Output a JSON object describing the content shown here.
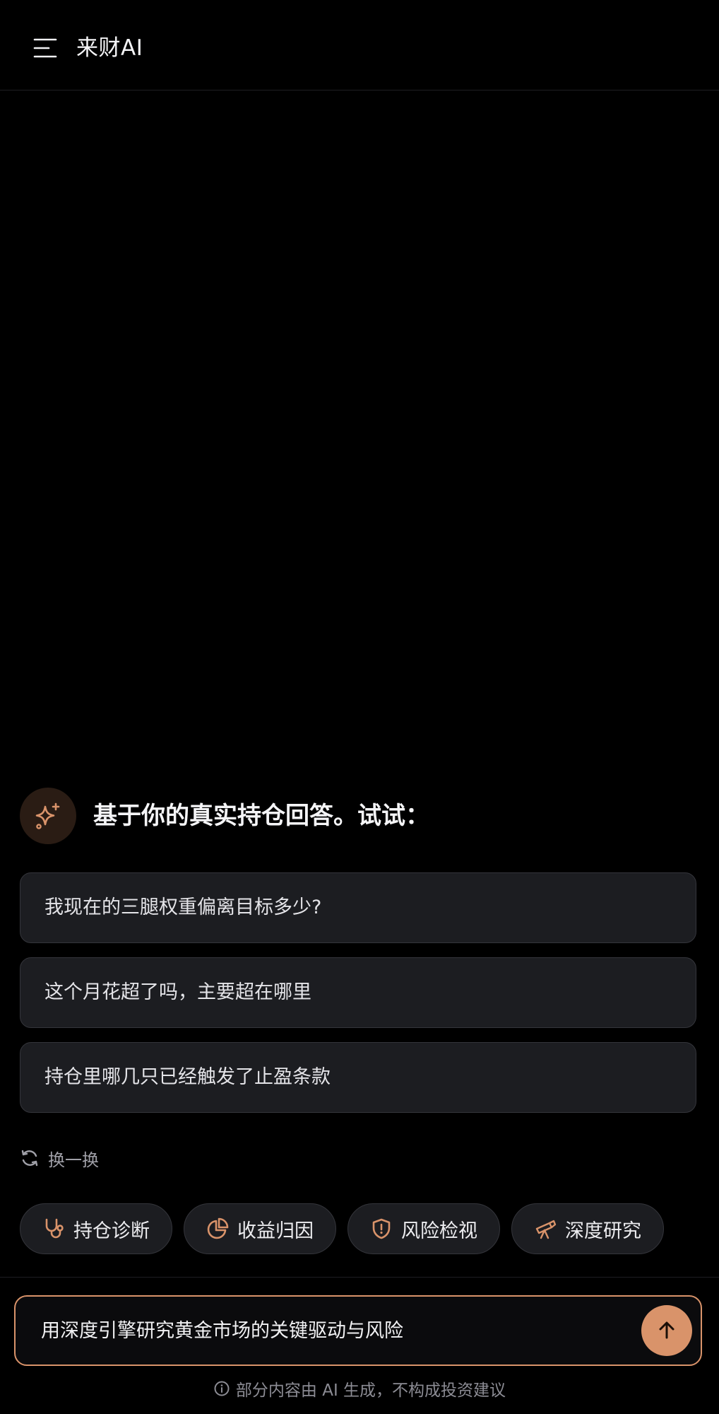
{
  "header": {
    "title": "来财AI",
    "menu_icon": "hamburger-menu-icon"
  },
  "prompt": {
    "icon": "sparkle-icon",
    "heading": "基于你的真实持仓回答。试试："
  },
  "suggestions": [
    {
      "text": "我现在的三腿权重偏离目标多少?"
    },
    {
      "text": "这个月花超了吗，主要超在哪里"
    },
    {
      "text": "持仓里哪几只已经触发了止盈条款"
    }
  ],
  "refresh": {
    "icon": "refresh-icon",
    "label": "换一换"
  },
  "chips": [
    {
      "label": "持仓诊断",
      "icon": "stethoscope-icon"
    },
    {
      "label": "收益归因",
      "icon": "pie-chart-icon"
    },
    {
      "label": "风险检视",
      "icon": "shield-alert-icon"
    },
    {
      "label": "深度研究",
      "icon": "telescope-icon"
    }
  ],
  "input": {
    "value": "用深度引擎研究黄金市场的关键驱动与风险",
    "send_icon": "arrow-up-icon"
  },
  "disclaimer": {
    "icon": "info-icon",
    "text": "部分内容由 AI 生成，不构成投资建议"
  },
  "colors": {
    "accent": "#d9936a",
    "background": "#000000",
    "card": "#1c1d21",
    "card_border": "#34353b"
  }
}
